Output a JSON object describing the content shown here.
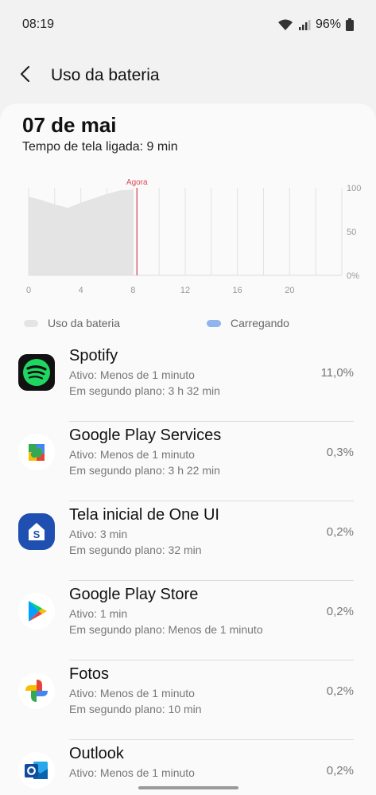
{
  "status": {
    "time": "08:19",
    "battery": "96%"
  },
  "header": {
    "title": "Uso da bateria",
    "back_icon": "arrow-back-icon"
  },
  "summary": {
    "date": "07 de mai",
    "screen_time": "Tempo de tela ligada: 9 min"
  },
  "chart_data": {
    "type": "area",
    "x": [
      0,
      1,
      2,
      3,
      4,
      5,
      6,
      7,
      8
    ],
    "values": [
      90,
      86,
      81,
      77,
      83,
      88,
      93,
      97,
      98
    ],
    "xlim": [
      0,
      24
    ],
    "ylim": [
      0,
      100
    ],
    "x_ticks": [
      "0",
      "4",
      "8",
      "12",
      "16",
      "20"
    ],
    "y_ticks": [
      "100",
      "50",
      "0%"
    ],
    "now_label": "Agora",
    "now_x": 8.3,
    "fill_color": "#e4e4e4",
    "now_color": "#d84a5a",
    "grid": true
  },
  "legend": {
    "usage": "Uso da bateria",
    "charging": "Carregando",
    "usage_color": "#e4e4e4",
    "charging_color": "#8fb4ee"
  },
  "apps": [
    {
      "name": "Spotify",
      "active": "Ativo: Menos de 1 minuto",
      "background": "Em segundo plano: 3 h 32 min",
      "percent": "11,0%",
      "icon": "spotify-icon"
    },
    {
      "name": "Google Play Services",
      "active": "Ativo: Menos de 1 minuto",
      "background": "Em segundo plano: 3 h 22 min",
      "percent": "0,3%",
      "icon": "play-services-icon"
    },
    {
      "name": "Tela inicial de One UI",
      "active": "Ativo: 3 min",
      "background": "Em segundo plano: 32 min",
      "percent": "0,2%",
      "icon": "one-ui-home-icon"
    },
    {
      "name": "Google Play Store",
      "active": "Ativo: 1 min",
      "background": "Em segundo plano: Menos de 1 minuto",
      "percent": "0,2%",
      "icon": "play-store-icon"
    },
    {
      "name": "Fotos",
      "active": "Ativo: Menos de 1 minuto",
      "background": "Em segundo plano: 10 min",
      "percent": "0,2%",
      "icon": "google-photos-icon"
    },
    {
      "name": "Outlook",
      "active": "Ativo: Menos de 1 minuto",
      "background": "",
      "percent": "0,2%",
      "icon": "outlook-icon"
    }
  ]
}
